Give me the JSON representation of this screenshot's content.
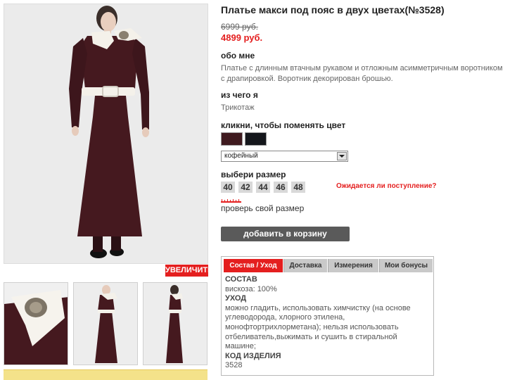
{
  "product": {
    "title": "Платье макси под пояс в двух цветах(№3528)",
    "old_price": "6999 руб.",
    "new_price": "4899 руб."
  },
  "zoom_label": "УВЕЛИЧИТЬ",
  "about": {
    "heading": "обо мне",
    "line1": "Платье с длинным втачным рукавом и отложным асимметричным воротником",
    "line2": "с драпировкой. Воротник декорирован брошью."
  },
  "material": {
    "heading": "из чего я",
    "text": "Трикотаж"
  },
  "color": {
    "heading": "кликни, чтобы поменять цвет",
    "swatches": [
      {
        "name": "кофейный",
        "hex": "#3f1a1f"
      },
      {
        "name": "черный",
        "hex": "#15171c"
      }
    ],
    "selected": "кофейный"
  },
  "size": {
    "heading": "выбери размер",
    "options": [
      "40",
      "42",
      "44",
      "46",
      "48"
    ],
    "waiting_link": "Ожидается ли поступление?",
    "check_link": "проверь свой размер"
  },
  "cart_button": "добавить в корзину",
  "tabs": {
    "items": [
      "Состав / Уход",
      "Доставка",
      "Измерения",
      "Мои бонусы"
    ],
    "active_index": 0
  },
  "composition": {
    "h1": "СОСТАВ",
    "composition_text": "вискоза: 100%",
    "h2": "УХОД",
    "care_lines": [
      "можно гладить, использовать химчистку (на основе",
      "углеводорода, хлорного этилена,",
      "монофтортрихлорметана); нельзя использовать",
      "отбеливатель,выжимать и сушить в стиральной",
      "машине;"
    ],
    "h3": "КОД ИЗДЕЛИЯ",
    "code": "3528"
  },
  "colors": {
    "accent_red": "#e41f1f",
    "dress_color": "#45191f",
    "button_gray": "#5a5a5a"
  }
}
